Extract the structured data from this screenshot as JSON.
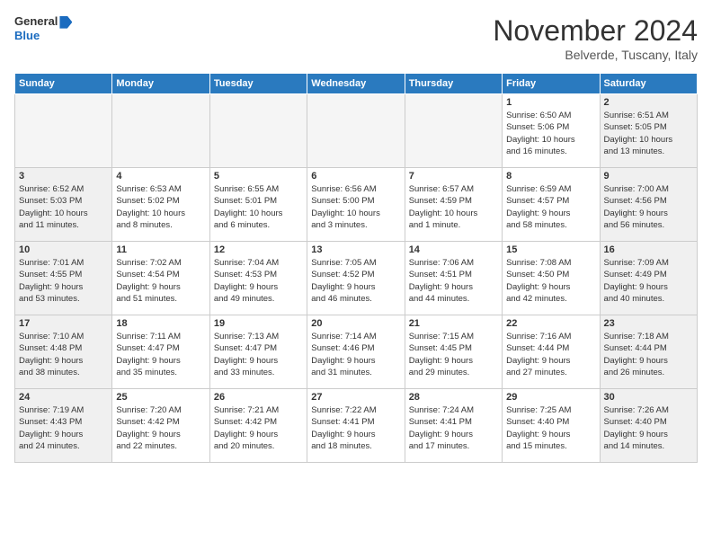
{
  "header": {
    "logo_line1": "General",
    "logo_line2": "Blue",
    "month": "November 2024",
    "location": "Belverde, Tuscany, Italy"
  },
  "weekdays": [
    "Sunday",
    "Monday",
    "Tuesday",
    "Wednesday",
    "Thursday",
    "Friday",
    "Saturday"
  ],
  "weeks": [
    [
      {
        "day": "",
        "info": ""
      },
      {
        "day": "",
        "info": ""
      },
      {
        "day": "",
        "info": ""
      },
      {
        "day": "",
        "info": ""
      },
      {
        "day": "",
        "info": ""
      },
      {
        "day": "1",
        "info": "Sunrise: 6:50 AM\nSunset: 5:06 PM\nDaylight: 10 hours\nand 16 minutes."
      },
      {
        "day": "2",
        "info": "Sunrise: 6:51 AM\nSunset: 5:05 PM\nDaylight: 10 hours\nand 13 minutes."
      }
    ],
    [
      {
        "day": "3",
        "info": "Sunrise: 6:52 AM\nSunset: 5:03 PM\nDaylight: 10 hours\nand 11 minutes."
      },
      {
        "day": "4",
        "info": "Sunrise: 6:53 AM\nSunset: 5:02 PM\nDaylight: 10 hours\nand 8 minutes."
      },
      {
        "day": "5",
        "info": "Sunrise: 6:55 AM\nSunset: 5:01 PM\nDaylight: 10 hours\nand 6 minutes."
      },
      {
        "day": "6",
        "info": "Sunrise: 6:56 AM\nSunset: 5:00 PM\nDaylight: 10 hours\nand 3 minutes."
      },
      {
        "day": "7",
        "info": "Sunrise: 6:57 AM\nSunset: 4:59 PM\nDaylight: 10 hours\nand 1 minute."
      },
      {
        "day": "8",
        "info": "Sunrise: 6:59 AM\nSunset: 4:57 PM\nDaylight: 9 hours\nand 58 minutes."
      },
      {
        "day": "9",
        "info": "Sunrise: 7:00 AM\nSunset: 4:56 PM\nDaylight: 9 hours\nand 56 minutes."
      }
    ],
    [
      {
        "day": "10",
        "info": "Sunrise: 7:01 AM\nSunset: 4:55 PM\nDaylight: 9 hours\nand 53 minutes."
      },
      {
        "day": "11",
        "info": "Sunrise: 7:02 AM\nSunset: 4:54 PM\nDaylight: 9 hours\nand 51 minutes."
      },
      {
        "day": "12",
        "info": "Sunrise: 7:04 AM\nSunset: 4:53 PM\nDaylight: 9 hours\nand 49 minutes."
      },
      {
        "day": "13",
        "info": "Sunrise: 7:05 AM\nSunset: 4:52 PM\nDaylight: 9 hours\nand 46 minutes."
      },
      {
        "day": "14",
        "info": "Sunrise: 7:06 AM\nSunset: 4:51 PM\nDaylight: 9 hours\nand 44 minutes."
      },
      {
        "day": "15",
        "info": "Sunrise: 7:08 AM\nSunset: 4:50 PM\nDaylight: 9 hours\nand 42 minutes."
      },
      {
        "day": "16",
        "info": "Sunrise: 7:09 AM\nSunset: 4:49 PM\nDaylight: 9 hours\nand 40 minutes."
      }
    ],
    [
      {
        "day": "17",
        "info": "Sunrise: 7:10 AM\nSunset: 4:48 PM\nDaylight: 9 hours\nand 38 minutes."
      },
      {
        "day": "18",
        "info": "Sunrise: 7:11 AM\nSunset: 4:47 PM\nDaylight: 9 hours\nand 35 minutes."
      },
      {
        "day": "19",
        "info": "Sunrise: 7:13 AM\nSunset: 4:47 PM\nDaylight: 9 hours\nand 33 minutes."
      },
      {
        "day": "20",
        "info": "Sunrise: 7:14 AM\nSunset: 4:46 PM\nDaylight: 9 hours\nand 31 minutes."
      },
      {
        "day": "21",
        "info": "Sunrise: 7:15 AM\nSunset: 4:45 PM\nDaylight: 9 hours\nand 29 minutes."
      },
      {
        "day": "22",
        "info": "Sunrise: 7:16 AM\nSunset: 4:44 PM\nDaylight: 9 hours\nand 27 minutes."
      },
      {
        "day": "23",
        "info": "Sunrise: 7:18 AM\nSunset: 4:44 PM\nDaylight: 9 hours\nand 26 minutes."
      }
    ],
    [
      {
        "day": "24",
        "info": "Sunrise: 7:19 AM\nSunset: 4:43 PM\nDaylight: 9 hours\nand 24 minutes."
      },
      {
        "day": "25",
        "info": "Sunrise: 7:20 AM\nSunset: 4:42 PM\nDaylight: 9 hours\nand 22 minutes."
      },
      {
        "day": "26",
        "info": "Sunrise: 7:21 AM\nSunset: 4:42 PM\nDaylight: 9 hours\nand 20 minutes."
      },
      {
        "day": "27",
        "info": "Sunrise: 7:22 AM\nSunset: 4:41 PM\nDaylight: 9 hours\nand 18 minutes."
      },
      {
        "day": "28",
        "info": "Sunrise: 7:24 AM\nSunset: 4:41 PM\nDaylight: 9 hours\nand 17 minutes."
      },
      {
        "day": "29",
        "info": "Sunrise: 7:25 AM\nSunset: 4:40 PM\nDaylight: 9 hours\nand 15 minutes."
      },
      {
        "day": "30",
        "info": "Sunrise: 7:26 AM\nSunset: 4:40 PM\nDaylight: 9 hours\nand 14 minutes."
      }
    ]
  ]
}
